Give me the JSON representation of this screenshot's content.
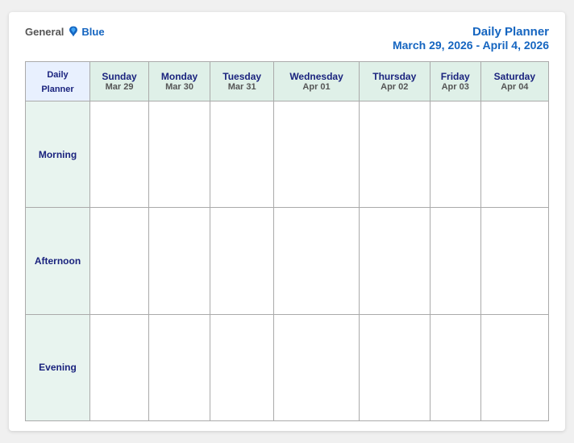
{
  "logo": {
    "general": "General",
    "blue": "Blue"
  },
  "title": "Daily Planner",
  "date_range": "March 29, 2026 - April 4, 2026",
  "header_row": {
    "col0": {
      "line1": "Daily",
      "line2": "Planner"
    },
    "col1": {
      "day": "Sunday",
      "date": "Mar 29"
    },
    "col2": {
      "day": "Monday",
      "date": "Mar 30"
    },
    "col3": {
      "day": "Tuesday",
      "date": "Mar 31"
    },
    "col4": {
      "day": "Wednesday",
      "date": "Apr 01"
    },
    "col5": {
      "day": "Thursday",
      "date": "Apr 02"
    },
    "col6": {
      "day": "Friday",
      "date": "Apr 03"
    },
    "col7": {
      "day": "Saturday",
      "date": "Apr 04"
    }
  },
  "rows": [
    {
      "label": "Morning"
    },
    {
      "label": "Afternoon"
    },
    {
      "label": "Evening"
    }
  ]
}
